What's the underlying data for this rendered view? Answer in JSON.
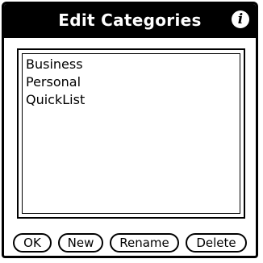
{
  "dialog": {
    "title": "Edit Categories",
    "info_icon": "info-icon"
  },
  "categories": [
    "Business",
    "Personal",
    "QuickList"
  ],
  "buttons": {
    "ok": "OK",
    "new": "New",
    "rename": "Rename",
    "delete": "Delete"
  }
}
